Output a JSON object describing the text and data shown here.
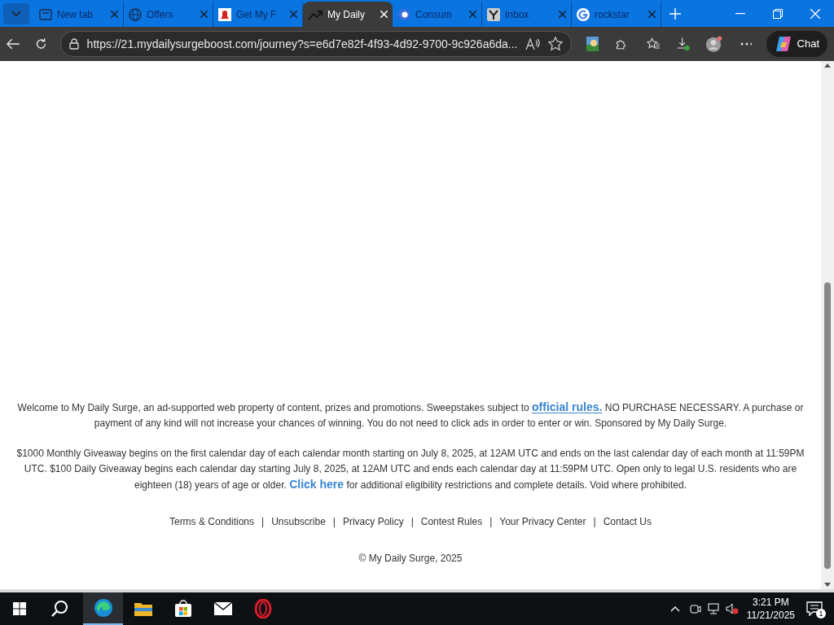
{
  "tabs": [
    {
      "label": "New tab",
      "kind": "newtab",
      "selected": false
    },
    {
      "label": "Offers",
      "kind": "globe",
      "selected": false
    },
    {
      "label": "Get My F",
      "kind": "bell",
      "selected": false
    },
    {
      "label": "My Daily",
      "kind": "trend",
      "selected": true
    },
    {
      "label": "Consum",
      "kind": "swirl",
      "selected": false
    },
    {
      "label": "Inbox",
      "kind": "yahoo",
      "selected": false
    },
    {
      "label": "rockstar",
      "kind": "google",
      "selected": false
    }
  ],
  "address_bar": {
    "url": "https://21.mydailysurgeboost.com/journey?s=e6d7e82f-4f93-4d92-9700-9c926a6da..."
  },
  "chat_button": "Chat",
  "footer": {
    "paragraphs": [
      {
        "before": "Welcome to My Daily Surge, an ad-supported web property of content, prizes and promotions. Sweepstakes subject to ",
        "link": "official rules.",
        "after": " NO PURCHASE NECESSARY. A purchase or payment of any kind will not increase your chances of winning. You do not need to click ads in order to enter or win. Sponsored by My Daily Surge."
      },
      {
        "before": "$1000 Monthly Giveaway begins on the first calendar day of each calendar month starting on July 8, 2025, at 12AM UTC and ends on the last calendar day of each month at 11:59PM UTC. $100 Daily Giveaway begins each calendar day starting July 8, 2025, at 12AM UTC and ends each calendar day at 11:59PM UTC. Open only to legal U.S. residents who are eighteen (18) years of age or older. ",
        "link": "Click here",
        "after": " for additional eligibility restrictions and complete details. Void where prohibited."
      }
    ],
    "links": [
      "Terms & Conditions",
      "Unsubscribe",
      "Privacy Policy",
      "Contest Rules",
      "Your Privacy Center",
      "Contact Us"
    ],
    "separator": "|",
    "copyright": "© My Daily Surge, 2025"
  },
  "taskbar": {
    "apps": [
      {
        "kind": "edge",
        "selected": true
      },
      {
        "kind": "folder",
        "selected": false
      },
      {
        "kind": "store",
        "selected": false
      },
      {
        "kind": "mail",
        "selected": false
      },
      {
        "kind": "opera",
        "selected": false
      }
    ],
    "time": "3:21 PM",
    "date": "11/21/2025",
    "notification_count": "1"
  }
}
